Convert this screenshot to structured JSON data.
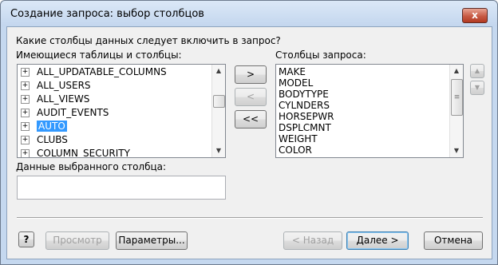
{
  "window": {
    "title": "Создание запроса: выбор столбцов",
    "close_glyph": "x"
  },
  "prompt": "Какие столбцы данных следует включить в запрос?",
  "available": {
    "label": "Имеющиеся таблицы и столбцы:",
    "items": [
      {
        "label": "ALL_UPDATABLE_COLUMNS",
        "selected": false
      },
      {
        "label": "ALL_USERS",
        "selected": false
      },
      {
        "label": "ALL_VIEWS",
        "selected": false
      },
      {
        "label": "AUDIT_EVENTS",
        "selected": false
      },
      {
        "label": "AUTO",
        "selected": true
      },
      {
        "label": "CLUBS",
        "selected": false
      },
      {
        "label": "COLUMN_SECURITY",
        "selected": false
      }
    ],
    "expand_glyph": "+"
  },
  "move_buttons": {
    "add": ">",
    "remove": "<",
    "remove_all": "<<"
  },
  "query_columns": {
    "label": "Столбцы запроса:",
    "items": [
      "MAKE",
      "MODEL",
      "BODYTYPE",
      "CYLNDERS",
      "HORSEPWR",
      "DSPLCMNT",
      "WEIGHT",
      "COLOR"
    ]
  },
  "order_buttons": {
    "up": "▲",
    "down": "▼"
  },
  "scroll_glyphs": {
    "up": "▲",
    "down": "▼",
    "grip": "≡"
  },
  "selected_column_data": {
    "label": "Данные выбранного столбца:",
    "value": ""
  },
  "footer": {
    "help_glyph": "?",
    "preview_label": "Просмотр",
    "options_label": "Параметры...",
    "back_label": "< Назад",
    "next_label": "Далее >",
    "cancel_label": "Отмена"
  }
}
